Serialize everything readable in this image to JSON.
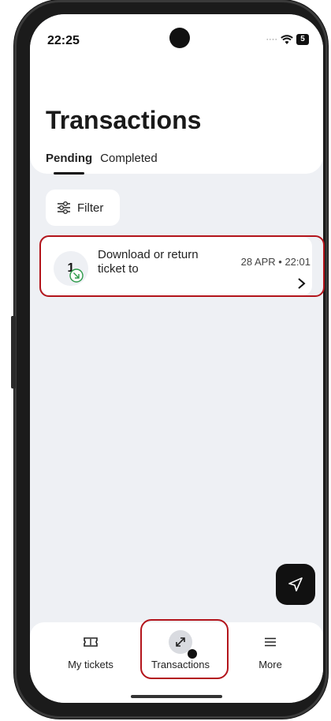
{
  "status_bar": {
    "time": "22:25",
    "battery": "5"
  },
  "page": {
    "title": "Transactions"
  },
  "tabs": [
    {
      "label": "Pending",
      "active": true
    },
    {
      "label": "Completed",
      "active": false
    }
  ],
  "filter": {
    "label": "Filter"
  },
  "transactions": [
    {
      "count": "1",
      "title": "Download or return ticket to",
      "date": "28 APR • 22:01"
    }
  ],
  "bottom_nav": {
    "items": [
      {
        "label": "My tickets",
        "icon": "ticket-icon",
        "active": false
      },
      {
        "label": "Transactions",
        "icon": "transfer-icon",
        "active": true
      },
      {
        "label": "More",
        "icon": "menu-icon",
        "active": false
      }
    ]
  },
  "colors": {
    "highlight": "#b3141b",
    "accent_green": "#2e9b4a",
    "background": "#eef0f4"
  }
}
